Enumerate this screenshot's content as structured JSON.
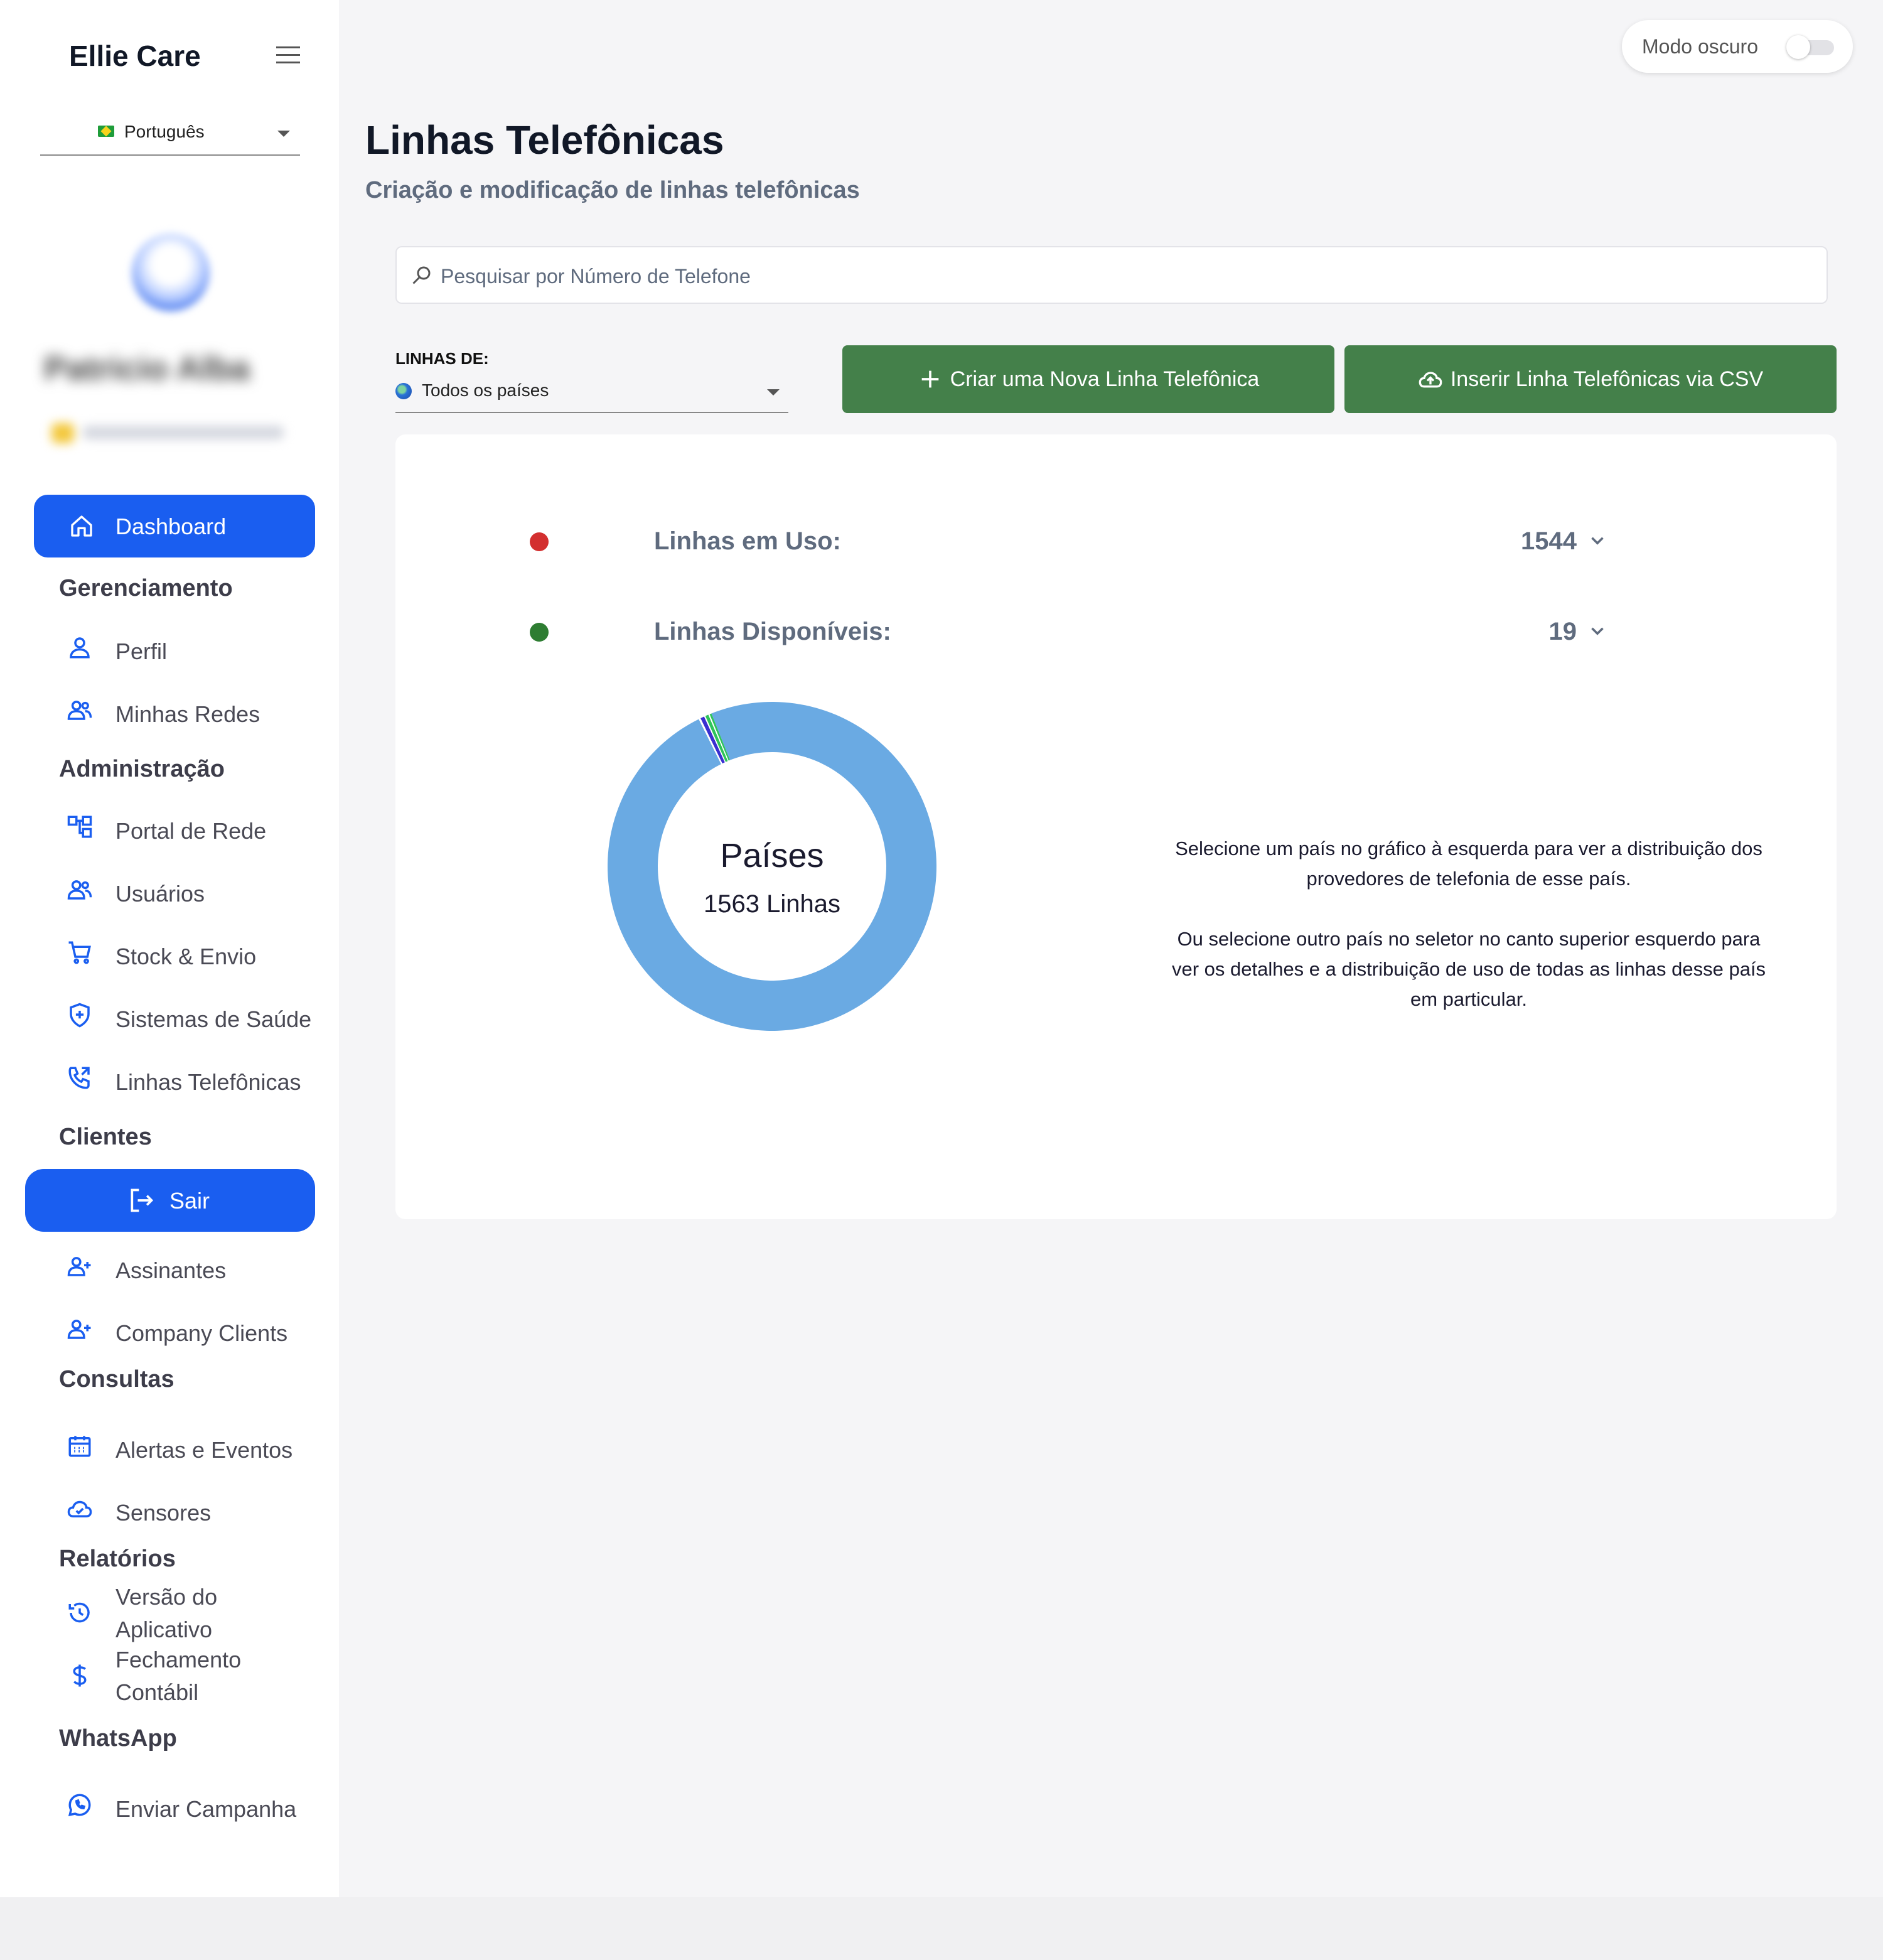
{
  "app": {
    "brand": "Ellie Care",
    "language": "Português"
  },
  "sidebar": {
    "user_name": "Patricio Alba",
    "active": {
      "label": "Dashboard",
      "icon": "home-icon"
    },
    "sections": [
      {
        "title": "Gerenciamento",
        "items": [
          {
            "label": "Perfil",
            "icon": "user-icon"
          },
          {
            "label": "Minhas Redes",
            "icon": "users-icon"
          }
        ]
      },
      {
        "title": "Administração",
        "items": [
          {
            "label": "Portal de Rede",
            "icon": "network-icon"
          },
          {
            "label": "Usuários",
            "icon": "users-icon"
          },
          {
            "label": "Stock & Envio",
            "icon": "cart-icon"
          },
          {
            "label": "Sistemas de Saúde",
            "icon": "shield-plus-icon"
          },
          {
            "label": "Linhas Telefônicas",
            "icon": "phone-icon"
          }
        ]
      },
      {
        "title": "Clientes",
        "items": [
          {
            "label": "Assinantes",
            "icon": "user-plus-icon"
          },
          {
            "label": "Company Clients",
            "icon": "user-plus-icon"
          }
        ]
      },
      {
        "title": "Consultas",
        "items": [
          {
            "label": "Alertas e Eventos",
            "icon": "calendar-icon"
          },
          {
            "label": "Sensores",
            "icon": "cloud-check-icon"
          }
        ]
      },
      {
        "title": "Relatórios",
        "items": [
          {
            "label": "Versão do Aplicativo",
            "icon": "history-icon"
          },
          {
            "label": "Fechamento Contábil",
            "icon": "dollar-icon"
          }
        ]
      },
      {
        "title": "WhatsApp",
        "items": [
          {
            "label": "Enviar Campanha",
            "icon": "whatsapp-icon"
          }
        ]
      }
    ],
    "logout_label": "Sair"
  },
  "header": {
    "dark_mode_label": "Modo oscuro",
    "dark_mode_on": false
  },
  "main": {
    "title": "Linhas Telefônicas",
    "subtitle": "Criação e modificação de linhas telefônicas",
    "search_placeholder": "Pesquisar por Número de Telefone",
    "filter_label": "LINHAS DE:",
    "filter_value": "Todos os países",
    "create_button": "Criar uma Nova Linha Telefônica",
    "csv_button": "Inserir Linha Telefônicas via CSV",
    "stats": [
      {
        "label": "Linhas em Uso:",
        "value": "1544",
        "color": "#d32f2f"
      },
      {
        "label": "Linhas Disponíveis:",
        "value": "19",
        "color": "#2e7d32"
      }
    ],
    "donut": {
      "title": "Países",
      "subtitle": "1563 Linhas"
    },
    "helper_p1": "Selecione um país no gráfico à esquerda para ver a distribuição dos provedores de telefonia de esse país.",
    "helper_p2": "Ou selecione outro país no seletor no canto superior esquerdo para ver os detalhes e a distribuição de uso de todas as linhas desse país em particular."
  },
  "chart_data": {
    "type": "pie",
    "title": "Países",
    "total": 1563,
    "slices": [
      {
        "value": 1542,
        "color": "#6aaae3"
      },
      {
        "value": 3,
        "color": "#ffffff"
      },
      {
        "value": 6,
        "color": "#3a2fd0"
      },
      {
        "value": 2,
        "color": "#ffffff"
      },
      {
        "value": 5,
        "color": "#2ec45a"
      },
      {
        "value": 2,
        "color": "#ffffff"
      },
      {
        "value": 3,
        "color": "#2ec45a"
      }
    ]
  }
}
